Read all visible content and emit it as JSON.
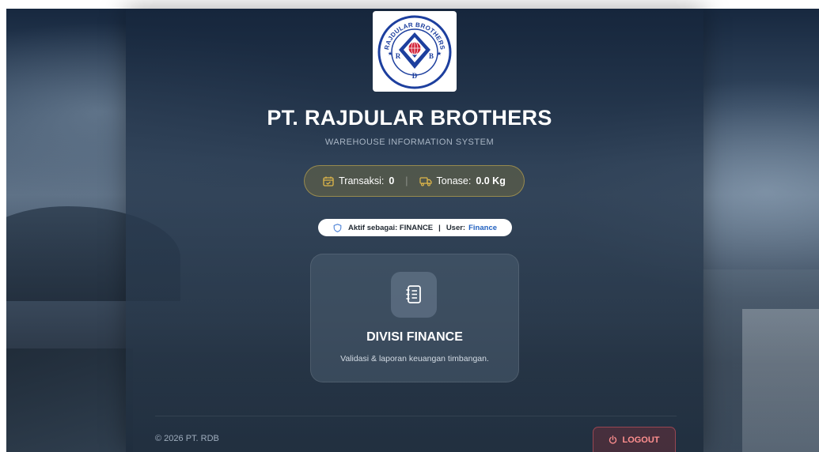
{
  "brand": {
    "title": "PT. RAJDULAR BROTHERS",
    "subtitle": "WAREHOUSE INFORMATION SYSTEM",
    "logo_ring_text": "RAJDULAR BROTHERS",
    "logo_letters": [
      "R",
      "D",
      "B"
    ]
  },
  "stats": {
    "transaksi_label": "Transaksi:",
    "transaksi_value": "0",
    "separator": "|",
    "tonase_label": "Tonase:",
    "tonase_value": "0.0 Kg"
  },
  "session": {
    "active_label": "Aktif sebagai: FINANCE",
    "separator": "|",
    "user_label": "User:",
    "user_name": "Finance"
  },
  "division_card": {
    "icon": "notebook-list-icon",
    "title": "DIVISI FINANCE",
    "description": "Validasi & laporan keuangan timbangan."
  },
  "footer": {
    "copyright": "© 2026 PT. RDB",
    "logout_label": "LOGOUT"
  },
  "colors": {
    "accent_gold": "#e0b84a",
    "logout_red": "#ff8f8f",
    "user_link": "#1f5fbf",
    "logo_blue": "#1d3f9e"
  }
}
